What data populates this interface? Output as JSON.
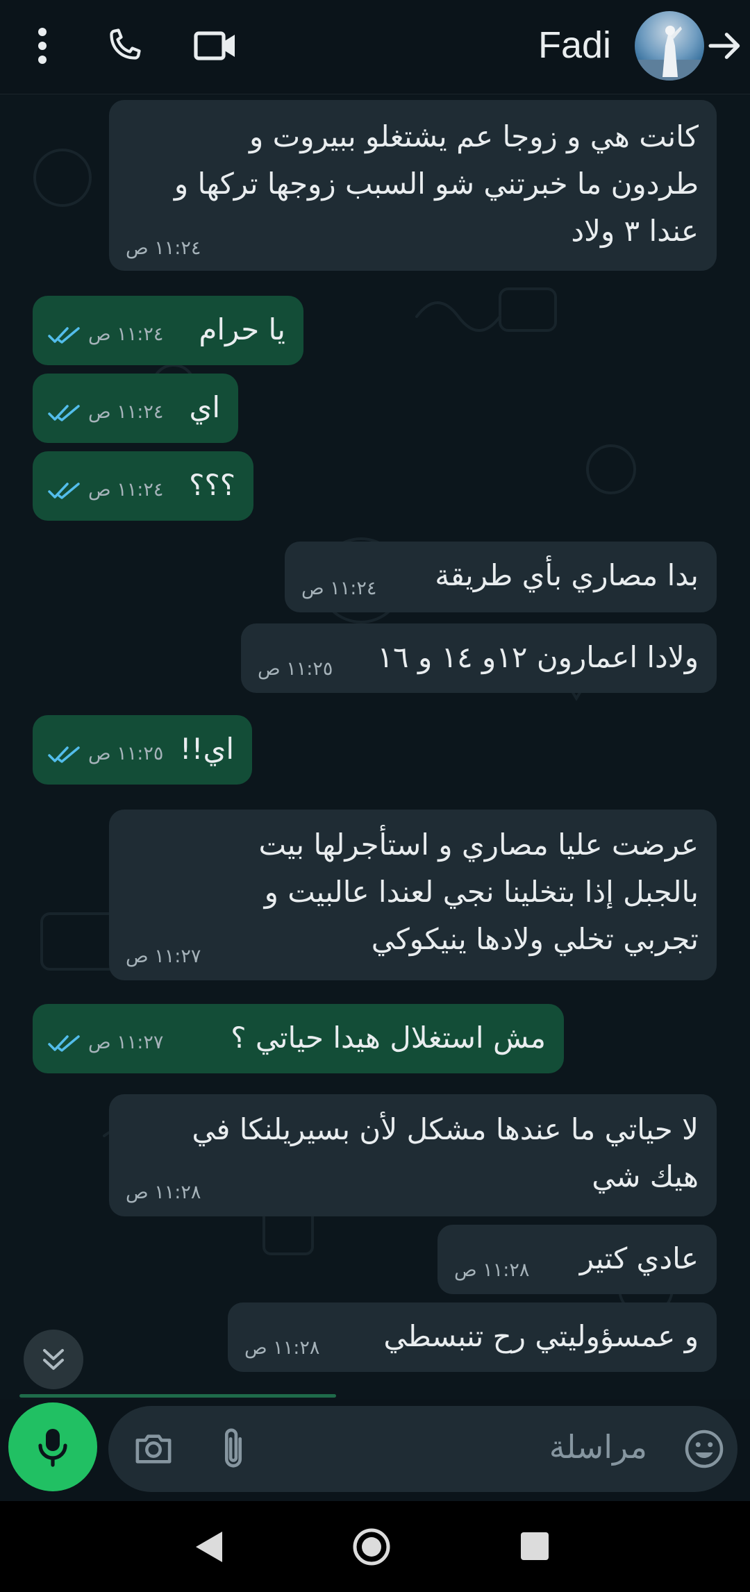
{
  "header": {
    "contact_name": "Fadi",
    "icons": [
      "menu-dots-icon",
      "voice-call-icon",
      "video-call-icon",
      "avatar",
      "back-arrow-icon"
    ]
  },
  "messages": [
    {
      "dir": "in",
      "lines": [
        "كانت هي و زوجا عم يشتغلو ببيروت و",
        "طردون ما خبرتني شو السبب زوجها تركها و",
        "عندا ٣ ولاد"
      ],
      "time": "١١:٢٤ ص"
    },
    {
      "dir": "out",
      "lines": [
        "يا حرام"
      ],
      "time": "١١:٢٤ ص",
      "read": true
    },
    {
      "dir": "out",
      "lines": [
        "اي"
      ],
      "time": "١١:٢٤ ص",
      "read": true
    },
    {
      "dir": "out",
      "lines": [
        "؟؟؟"
      ],
      "time": "١١:٢٤ ص",
      "read": true
    },
    {
      "dir": "in",
      "lines": [
        "بدا مصاري بأي طريقة"
      ],
      "time": "١١:٢٤ ص"
    },
    {
      "dir": "in",
      "lines": [
        "ولادا اعمارون ١٢و ١٤ و ١٦"
      ],
      "time": "١١:٢٥ ص"
    },
    {
      "dir": "out",
      "lines": [
        "اي!!"
      ],
      "time": "١١:٢٥ ص",
      "read": true
    },
    {
      "dir": "in",
      "lines": [
        "عرضت عليا مصاري و استأجرلها بيت",
        "بالجبل إذا بتخلينا نجي لعندا عالبيت و",
        "تجربي تخلي ولادها ينيكوكي"
      ],
      "time": "١١:٢٧ ص"
    },
    {
      "dir": "out",
      "lines": [
        "مش استغلال هيدا حياتي ؟"
      ],
      "time": "١١:٢٧ ص",
      "read": true
    },
    {
      "dir": "in",
      "lines": [
        "لا حياتي ما عندها مشكل لأن بسيريلنكا في",
        "هيك شي"
      ],
      "time": "١١:٢٨ ص"
    },
    {
      "dir": "in",
      "lines": [
        "عادي كتير"
      ],
      "time": "١١:٢٨ ص"
    },
    {
      "dir": "in",
      "lines": [
        "و عمسؤوليتي رح تنبسطي"
      ],
      "time": "١١:٢٨ ص"
    }
  ],
  "composer": {
    "placeholder": "مراسلة",
    "icons": [
      "emoji-icon",
      "attach-icon",
      "camera-icon",
      "mic-icon"
    ]
  },
  "scroll_down_icon": "double-chevron-down-icon",
  "navbar": {
    "icons": [
      "nav-back-icon",
      "nav-home-icon",
      "nav-recents-icon"
    ]
  },
  "colors": {
    "background": "#0b141a",
    "incoming_bubble": "#1f2c34",
    "outgoing_bubble": "#134d37",
    "read_ticks": "#53bdeb",
    "accent_green": "#21c063"
  }
}
